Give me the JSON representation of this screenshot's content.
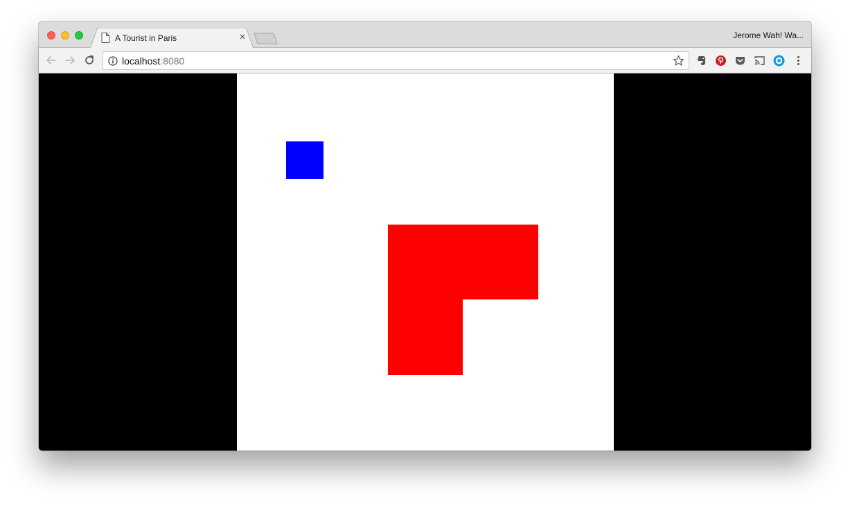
{
  "tab": {
    "title": "A Tourist in Paris",
    "close_glyph": "×",
    "icon": "page-icon"
  },
  "profile": {
    "name": "Jerome Wah! Wa..."
  },
  "toolbar": {
    "back_icon": "back-arrow-icon",
    "forward_icon": "forward-arrow-icon",
    "reload_icon": "reload-icon"
  },
  "address": {
    "host": "localhost",
    "port": ":8080",
    "info_icon": "info-icon",
    "bookmark_icon": "star-icon"
  },
  "extensions": [
    "evernote-icon",
    "pinterest-icon",
    "pocket-icon",
    "cast-icon",
    "extension-circle-icon",
    "more-menu-icon"
  ],
  "game": {
    "background_color": "#000000",
    "board_color": "#ffffff",
    "player_color": "#0000ff",
    "block_color": "#ff0000"
  }
}
